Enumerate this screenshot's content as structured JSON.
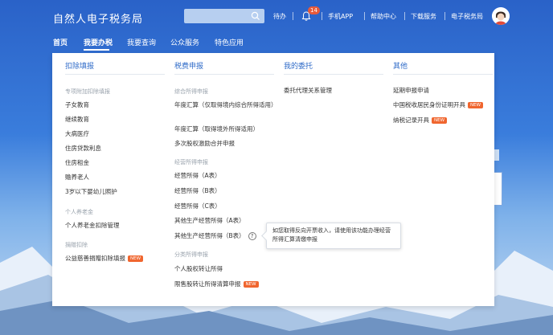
{
  "header": {
    "site_title": "自然人电子税务局",
    "search_placeholder": "",
    "links": [
      "待办",
      "手机APP",
      "帮助中心",
      "下载服务",
      "电子税务局"
    ],
    "notification_count": "14"
  },
  "nav": {
    "items": [
      "首页",
      "我要办税",
      "我要查询",
      "公众服务",
      "特色应用"
    ],
    "active_index": 1
  },
  "menu": {
    "col1": {
      "heading": "扣除填报",
      "section1": "专项附加扣除填报",
      "section1_items": [
        "子女教育",
        "继续教育",
        "大病医疗",
        "住房贷款利息",
        "住房租金",
        "赡养老人",
        "3岁以下婴幼儿照护"
      ],
      "section2": "个人养老金",
      "section2_items": [
        "个人养老金扣除管理"
      ],
      "section3": "捐赠扣除",
      "section3_items": [
        "公益慈善捐赠扣除填报"
      ]
    },
    "col2": {
      "heading": "税费申报",
      "section1": "综合所得申报",
      "section1_items": [
        "年度汇算（仅取得境内综合所得适用）",
        "年度汇算（取得境外所得适用）",
        "多次股权激励合并申报"
      ],
      "section2": "经营所得申报",
      "section2_items": [
        "经营所得（A表）",
        "经营所得（B表）",
        "经营所得（C表）",
        "其他生产经营所得（A表）",
        "其他生产经营所得（B表）"
      ],
      "section3": "分类所得申报",
      "section3_items": [
        "个人股权转让所得",
        "限售股转让所得清算申报"
      ]
    },
    "col3": {
      "heading": "我的委托",
      "items": [
        "委托代理关系管理"
      ]
    },
    "col4": {
      "heading": "其他",
      "items": [
        "延期申报申请",
        "中国税收居民身份证明开具",
        "纳税记录开具"
      ]
    },
    "new_label": "NEW"
  },
  "tooltip": {
    "text": "如您取得反向开票收入，请使用该功能办理经营所得汇算清缴申报"
  },
  "colors": {
    "accent": "#2f6bc8",
    "new_badge": "#f0662f",
    "header_bg": "#2a62c8"
  }
}
